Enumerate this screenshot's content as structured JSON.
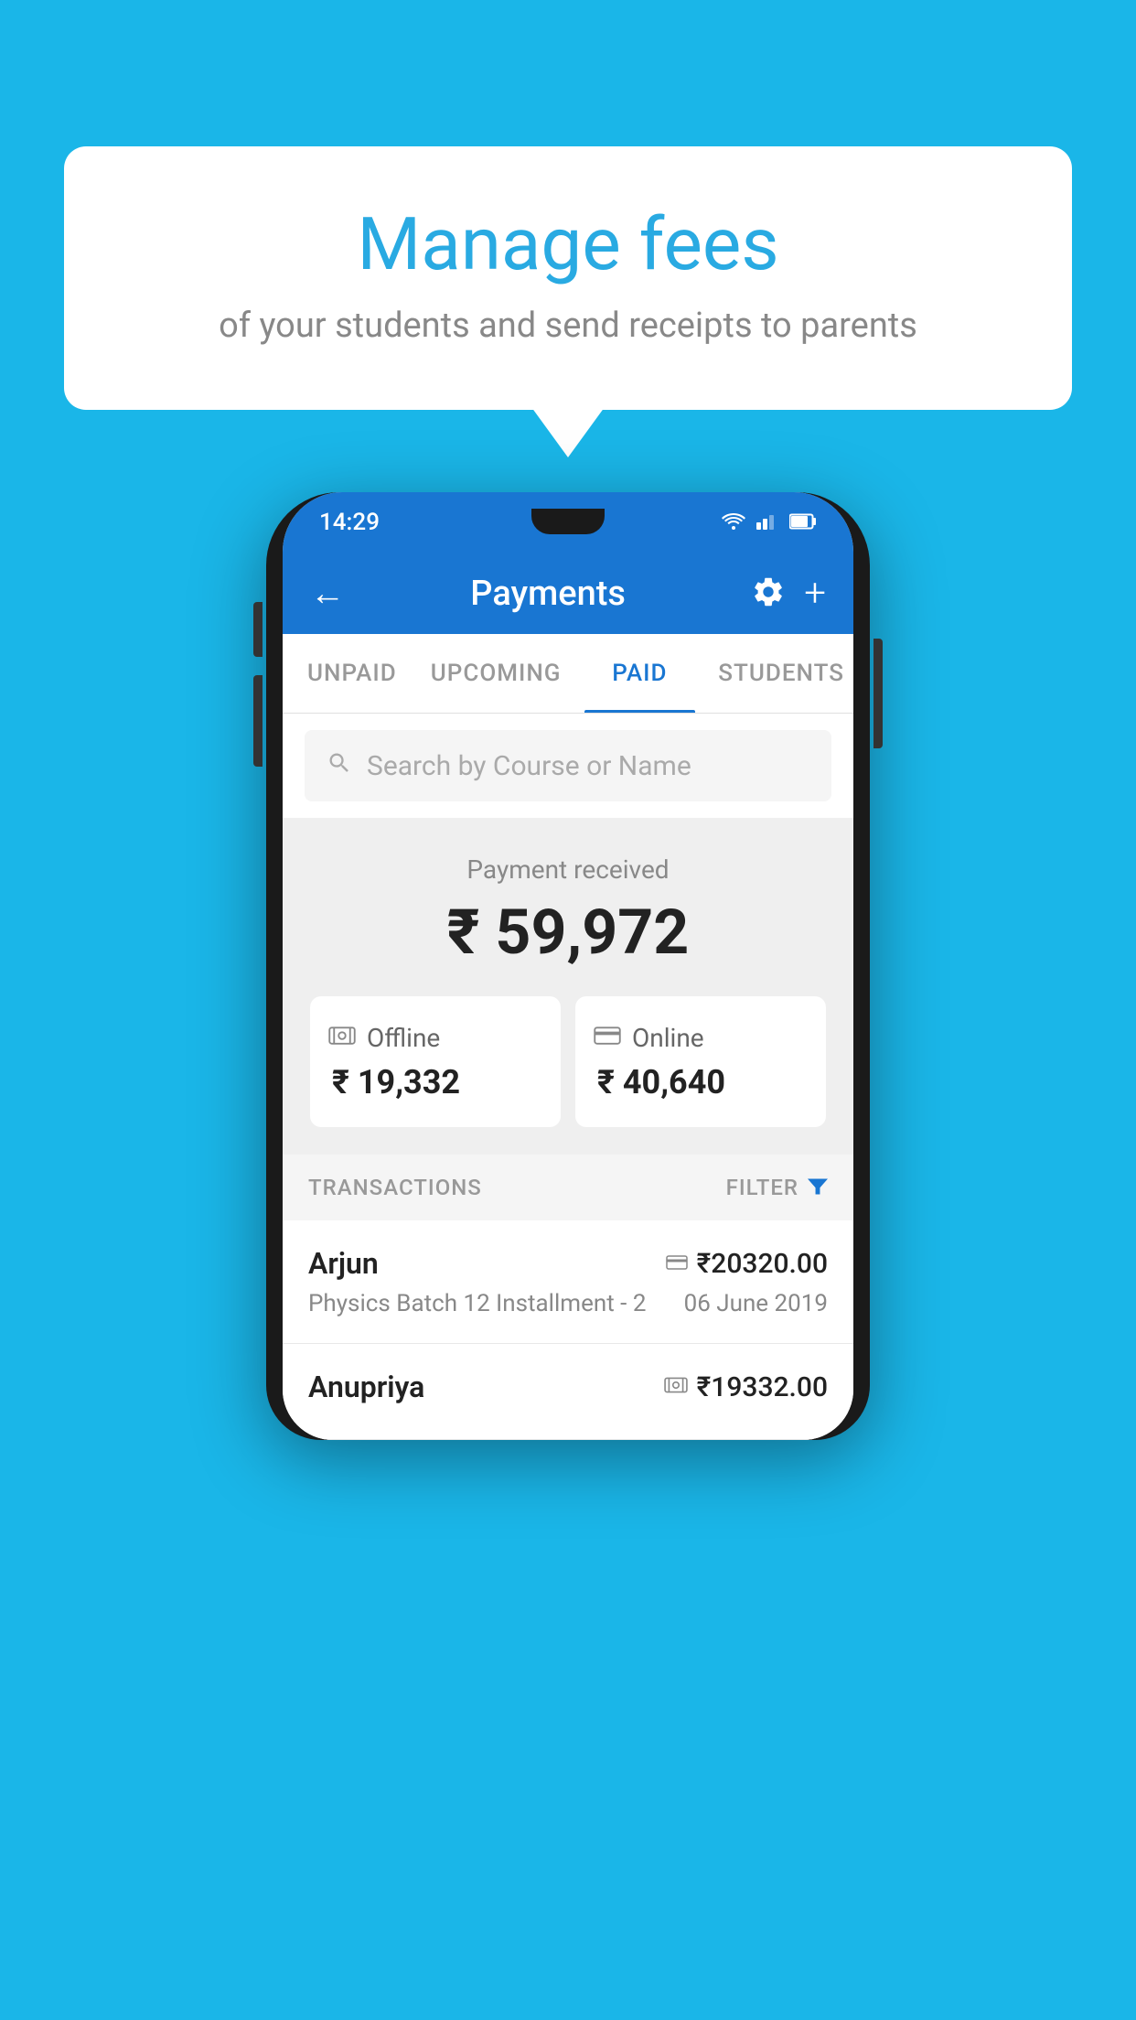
{
  "page": {
    "background_color": "#1ab6e8"
  },
  "speech_bubble": {
    "title": "Manage fees",
    "subtitle": "of your students and send receipts to parents"
  },
  "status_bar": {
    "time": "14:29",
    "wifi_icon": "wifi",
    "signal_icon": "signal",
    "battery_icon": "battery"
  },
  "app_bar": {
    "back_label": "←",
    "title": "Payments",
    "settings_icon": "gear",
    "add_icon": "+"
  },
  "tabs": [
    {
      "id": "unpaid",
      "label": "UNPAID",
      "active": false
    },
    {
      "id": "upcoming",
      "label": "UPCOMING",
      "active": false
    },
    {
      "id": "paid",
      "label": "PAID",
      "active": true
    },
    {
      "id": "students",
      "label": "STUDENTS",
      "active": false
    }
  ],
  "search": {
    "placeholder": "Search by Course or Name"
  },
  "payment_summary": {
    "label": "Payment received",
    "total_amount": "₹ 59,972",
    "offline": {
      "type": "Offline",
      "amount": "₹ 19,332",
      "icon": "cash-icon"
    },
    "online": {
      "type": "Online",
      "amount": "₹ 40,640",
      "icon": "card-icon"
    }
  },
  "transactions": {
    "section_label": "TRANSACTIONS",
    "filter_label": "FILTER",
    "items": [
      {
        "name": "Arjun",
        "payment_method_icon": "card",
        "amount": "₹20320.00",
        "detail": "Physics Batch 12 Installment - 2",
        "date": "06 June 2019"
      },
      {
        "name": "Anupriya",
        "payment_method_icon": "cash",
        "amount": "₹19332.00",
        "detail": "",
        "date": ""
      }
    ]
  }
}
